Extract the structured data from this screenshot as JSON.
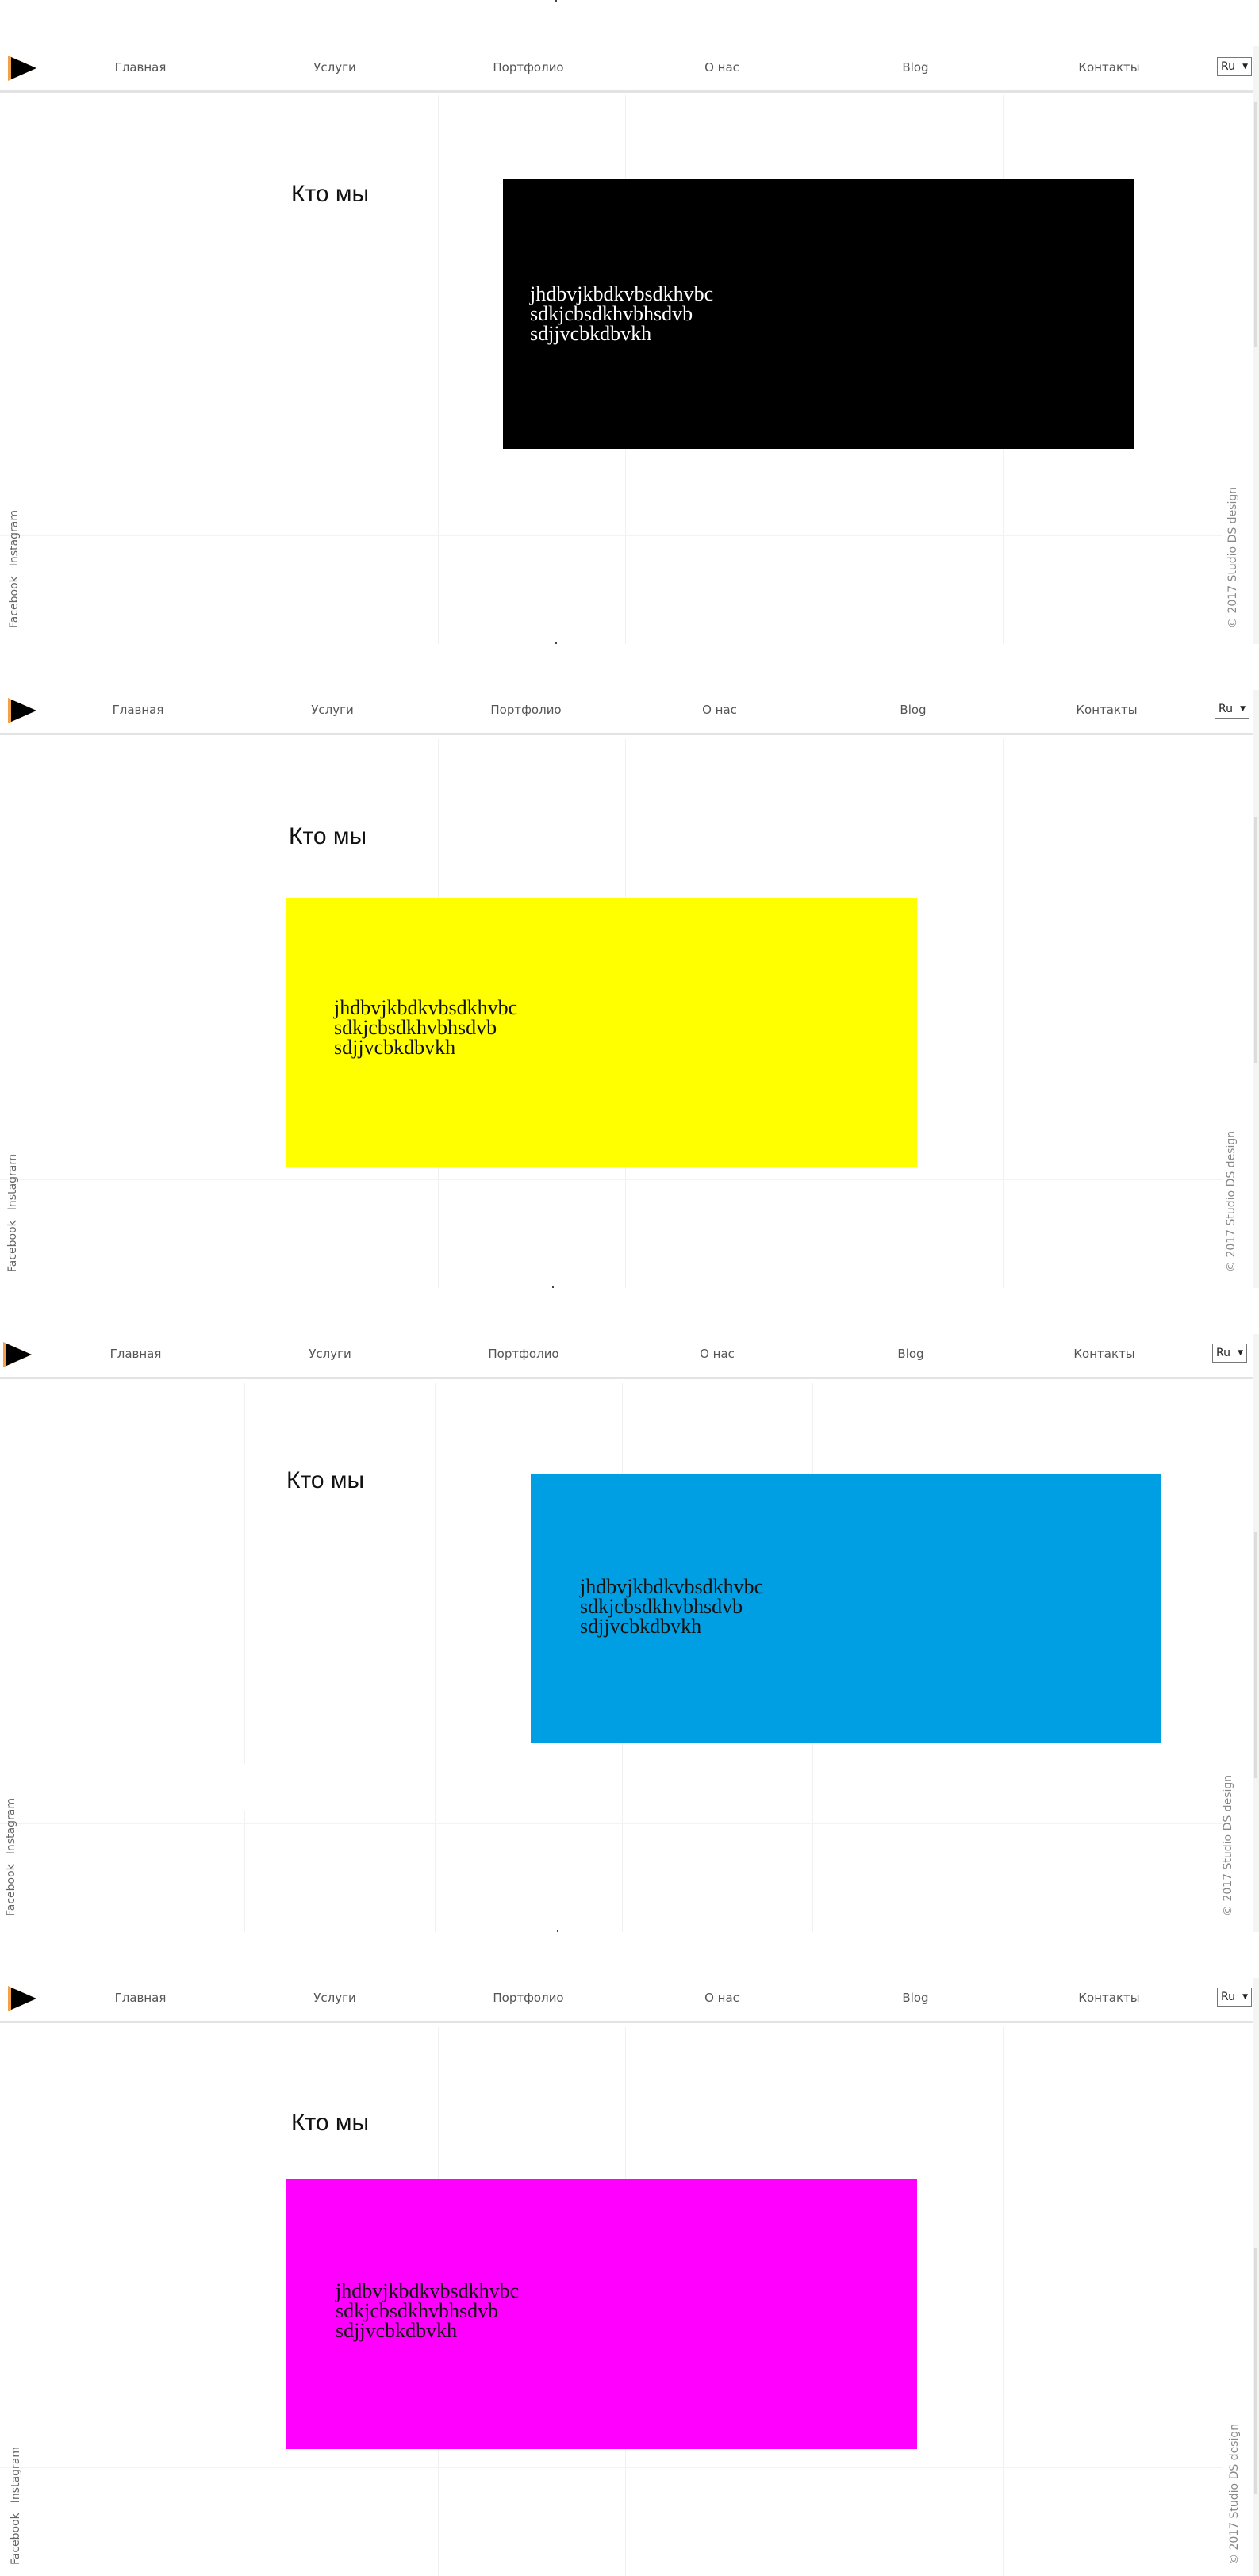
{
  "nav": {
    "home": "Главная",
    "services": "Услуги",
    "portfolio": "Портфолио",
    "about": "О нас",
    "blog": "Blog",
    "contacts": "Контакты"
  },
  "language": "Ru",
  "title": "Кто мы",
  "card_text": [
    "jhdbvjkbdkvbsdkhvbc",
    "sdkjcbsdkhvbhsdvb",
    "sdjjvcbkdbvkh"
  ],
  "social": {
    "facebook": "Facebook",
    "instagram": "Instagram"
  },
  "copyright": "© 2017 Studio DS design",
  "screens": [
    {
      "card_color": "#000000",
      "text_color": "#ffffff"
    },
    {
      "card_color": "#ffff00",
      "text_color": "#111111"
    },
    {
      "card_color": "#009fe3",
      "text_color": "#111111"
    },
    {
      "card_color": "#ff00ff",
      "text_color": "#111111"
    }
  ]
}
